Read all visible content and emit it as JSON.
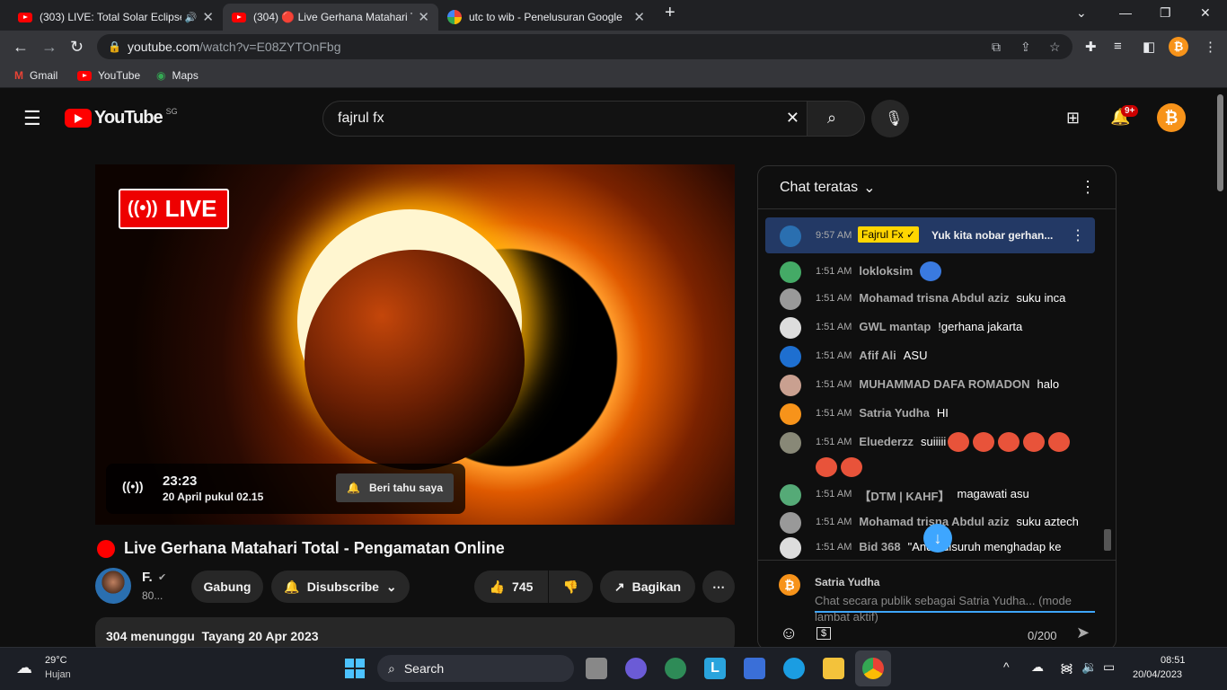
{
  "browser": {
    "tabs": [
      {
        "title": "(303) LIVE: Total Solar Eclipse",
        "active": false
      },
      {
        "title": "(304) 🔴 Live Gerhana Matahari T",
        "active": true
      },
      {
        "title": "utc to wib - Penelusuran Google",
        "active": false
      }
    ],
    "url_host": "youtube.com",
    "url_path": "/watch?v=E08ZYTOnFbg",
    "bookmarks": [
      "Gmail",
      "YouTube",
      "Maps"
    ]
  },
  "youtube": {
    "logo_text": "YouTube",
    "region": "SG",
    "search_value": "fajrul fx",
    "notification_count": "9+",
    "avatar_letter": "₿"
  },
  "video": {
    "live_label": "LIVE",
    "premiere_time": "23:23",
    "premiere_date": "20 April pukul 02.15",
    "notify_label": "Beri tahu saya",
    "title": "Live Gerhana Matahari Total - Pengamatan Online",
    "channel_name": "F.",
    "subs_count": "80...",
    "join_label": "Gabung",
    "subscribe_label": "Disubscribe",
    "like_count": "745",
    "share_label": "Bagikan",
    "desc_waiting": "304 menunggu",
    "desc_date": "Tayang 20 Apr 2023"
  },
  "chat": {
    "header": "Chat teratas",
    "pinned": {
      "time": "9:57 AM",
      "author": "Fajrul Fx ✓",
      "text": "Yuk kita nobar gerhan..."
    },
    "messages": [
      {
        "time": "1:51 AM",
        "author": "lokloksim",
        "text": ""
      },
      {
        "time": "1:51 AM",
        "author": "Mohamad trisna Abdul aziz",
        "text": "suku inca"
      },
      {
        "time": "1:51 AM",
        "author": "GWL mantap",
        "text": "!gerhana jakarta"
      },
      {
        "time": "1:51 AM",
        "author": "Afif Ali",
        "text": "ASU"
      },
      {
        "time": "1:51 AM",
        "author": "MUHAMMAD DAFA ROMADON",
        "text": "halo"
      },
      {
        "time": "1:51 AM",
        "author": "Satria Yudha",
        "text": "HI"
      },
      {
        "time": "1:51 AM",
        "author": "Eluederzz",
        "text": "suiiiii"
      },
      {
        "time": "1:51 AM",
        "author": "【DTM | KAHF】",
        "text": "magawati asu"
      },
      {
        "time": "1:51 AM",
        "author": "Mohamad trisna Abdul aziz",
        "text": "suku aztech"
      },
      {
        "time": "1:51 AM",
        "author": "Bid 368",
        "text": "\"Anda disuruh menghadap ke"
      }
    ],
    "current_user": "Satria Yudha",
    "input_placeholder": "Chat secara publik sebagai Satria Yudha... (mode lambat aktif)",
    "char_count": "0/200",
    "colors": {
      "pinned_bg": "#233965",
      "accent": "#3ea6ff"
    }
  },
  "taskbar": {
    "weather_temp": "29°C",
    "weather_desc": "Hujan",
    "search_label": "Search",
    "time": "08:51",
    "date": "20/04/2023"
  }
}
